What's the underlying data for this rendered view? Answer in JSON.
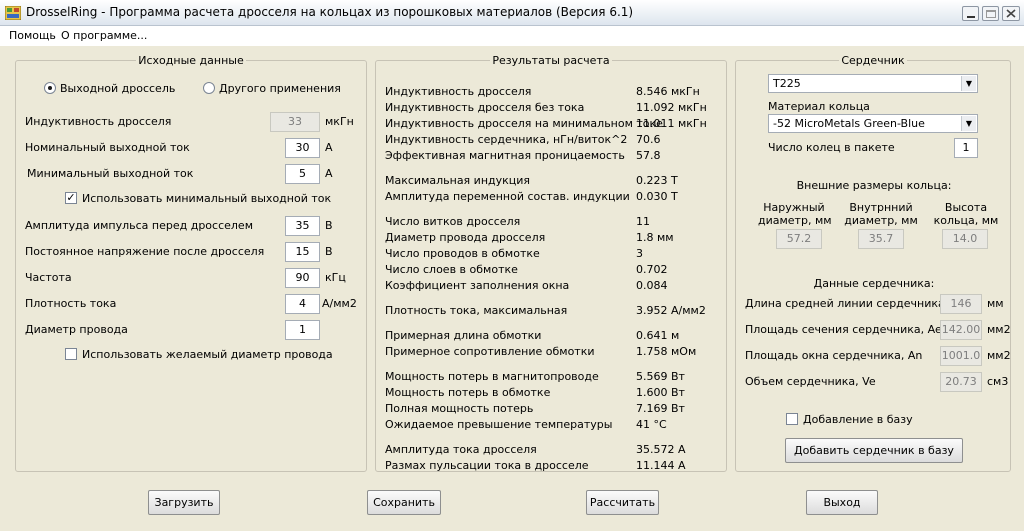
{
  "window": {
    "title": "DrosselRing - Программа расчета дросселя на кольцах из порошковых материалов (Версия 6.1)"
  },
  "menu": [
    "Помощь",
    "О программе..."
  ],
  "input": {
    "title": "Исходные данные",
    "radio_output": "Выходной дроссель",
    "radio_other": "Другого применения",
    "inductance_label": "Индуктивность  дросселя",
    "inductance_value": "33",
    "inductance_unit": "мкГн",
    "nominal_current_label": "Номинальный выходной ток",
    "nominal_current_value": "30",
    "nominal_current_unit": "А",
    "min_current_label": "Минимальный выходной ток",
    "min_current_value": "5",
    "min_current_unit": "А",
    "use_min_current_label": "Использовать минимальный выходной ток",
    "pulse_amplitude_label": "Амплитуда импульса перед дросселем",
    "pulse_amplitude_value": "35",
    "pulse_amplitude_unit": "В",
    "dc_voltage_label": "Постоянное напряжение после дросселя",
    "dc_voltage_value": "15",
    "dc_voltage_unit": "В",
    "frequency_label": "Частота",
    "frequency_value": "90",
    "frequency_unit": "кГц",
    "current_density_label": "Плотность тока",
    "current_density_value": "4",
    "current_density_unit": "А/мм2",
    "wire_diameter_label": "Диаметр провода",
    "wire_diameter_value": "1",
    "use_wire_diameter_label": "Использовать желаемый диаметр провода"
  },
  "results": {
    "title": "Результаты расчета",
    "rows": [
      {
        "label": "Индуктивность дросселя",
        "value": "8.546 мкГн"
      },
      {
        "label": "Индуктивность дросселя без тока",
        "value": "11.092 мкГн"
      },
      {
        "label": "Индуктивность дросселя на минимальном токе",
        "value": "11.011 мкГн"
      },
      {
        "label": "Индуктивность сердечника, нГн/виток^2",
        "value": "70.6"
      },
      {
        "label": "Эффективная магнитная проницаемость",
        "value": "57.8"
      },
      {
        "label": "Максимальная индукция",
        "value": "0.223 Т"
      },
      {
        "label": "Амплитуда переменной состав. индукции",
        "value": "0.030 Т"
      },
      {
        "label": "Число витков дросселя",
        "value": "11"
      },
      {
        "label": "Диаметр провода дросселя",
        "value": "1.8 мм"
      },
      {
        "label": "Число проводов в обмотке",
        "value": "3"
      },
      {
        "label": "Число слоев в обмотке",
        "value": "0.702"
      },
      {
        "label": "Коэффициент заполнения окна",
        "value": "0.084"
      },
      {
        "label": "Плотность тока, максимальная",
        "value": "3.952 А/мм2"
      },
      {
        "label": "Примерная длина обмотки",
        "value": "0.641 м"
      },
      {
        "label": "Примерное сопротивление обмотки",
        "value": "1.758 мОм"
      },
      {
        "label": "Мощность потерь в магнитопроводе",
        "value": "5.569 Вт"
      },
      {
        "label": "Мощность потерь в обмотке",
        "value": "1.600 Вт"
      },
      {
        "label": "Полная мощность потерь",
        "value": "7.169 Вт"
      },
      {
        "label": "Ожидаемое превышение температуры",
        "value": "41 °C"
      },
      {
        "label": "Амплитуда тока дросселя",
        "value": "35.572 А"
      },
      {
        "label": "Размах пульсации тока в дросселе",
        "value": "11.144 А"
      }
    ]
  },
  "core": {
    "title": "Сердечник",
    "core_select": "T225",
    "material_label": "Материал кольца",
    "material_select": "-52 MicroMetals Green-Blue",
    "rings_label": "Число колец в пакете",
    "rings_value": "1",
    "dims_title": "Внешние размеры кольца:",
    "outer_label_1": "Наружный",
    "outer_label_2": "диаметр, мм",
    "inner_label_1": "Внутрнний",
    "inner_label_2": "диаметр, мм",
    "height_label_1": "Высота",
    "height_label_2": "кольца, мм",
    "outer_value": "57.2",
    "inner_value": "35.7",
    "height_value": "14.0",
    "data_title": "Данные сердечника:",
    "le_label": "Длина средней линии сердечника, le",
    "le_value": "146",
    "le_unit": "мм",
    "ae_label": "Площадь сечения сердечника, Ae",
    "ae_value": "142.00",
    "ae_unit": "мм2",
    "an_label": "Площадь окна сердечника, An",
    "an_value": "1001.0",
    "an_unit": "мм2",
    "ve_label": "Объем сердечника, Ve",
    "ve_value": "20.73",
    "ve_unit": "см3",
    "add_to_db_check": "Добавление в базу",
    "add_core_button": "Добавить сердечник в базу"
  },
  "buttons": {
    "load": "Загрузить",
    "save": "Сохранить",
    "calc": "Рассчитать",
    "exit": "Выход"
  }
}
